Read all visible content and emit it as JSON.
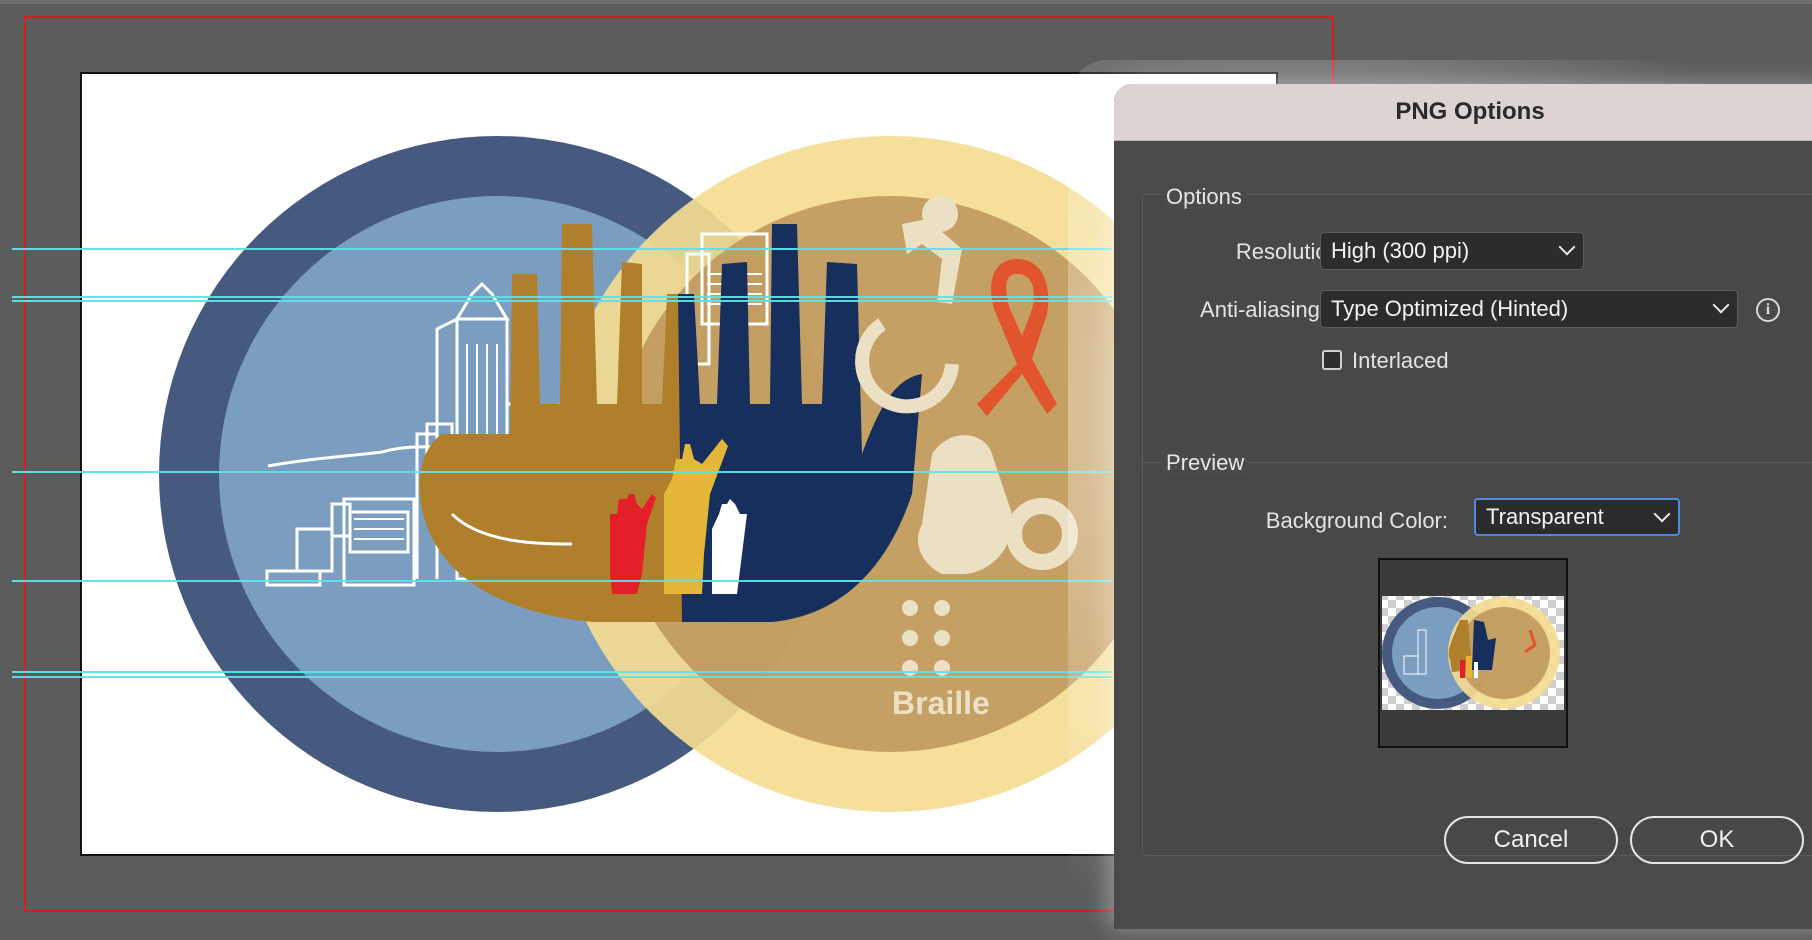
{
  "dialog": {
    "title": "PNG Options",
    "options_group_label": "Options",
    "resolution_label": "Resolution:",
    "resolution_value": "High (300 ppi)",
    "antialiasing_label": "Anti-aliasing:",
    "antialiasing_value": "Type Optimized (Hinted)",
    "interlaced_label": "Interlaced",
    "interlaced_checked": false,
    "preview_group_label": "Preview",
    "background_color_label": "Background Color:",
    "background_color_value": "Transparent",
    "cancel_label": "Cancel",
    "ok_label": "OK"
  },
  "artwork": {
    "braille_text": "Braille"
  },
  "icons": {
    "info": "info-icon",
    "dropdown": "chevron-down-icon",
    "wheelchair": "wheelchair-icon",
    "ribbon": "awareness-ribbon-icon",
    "sign_language": "sign-language-icon",
    "braille": "braille-dots-icon"
  },
  "colors": {
    "bleed_guide": "#d21f1f",
    "ruler_guides": "#5be3e8",
    "navy_ring": "#465a7f",
    "light_blue_fill": "#7a9dc0",
    "gold_ring": "#f4dc91",
    "gold_fill": "#bc955a",
    "brown_hand": "#b07f2c",
    "navy_hand": "#172f5c",
    "focus_blue": "#4b8ae0",
    "ribbon_red": "#e2542e"
  }
}
